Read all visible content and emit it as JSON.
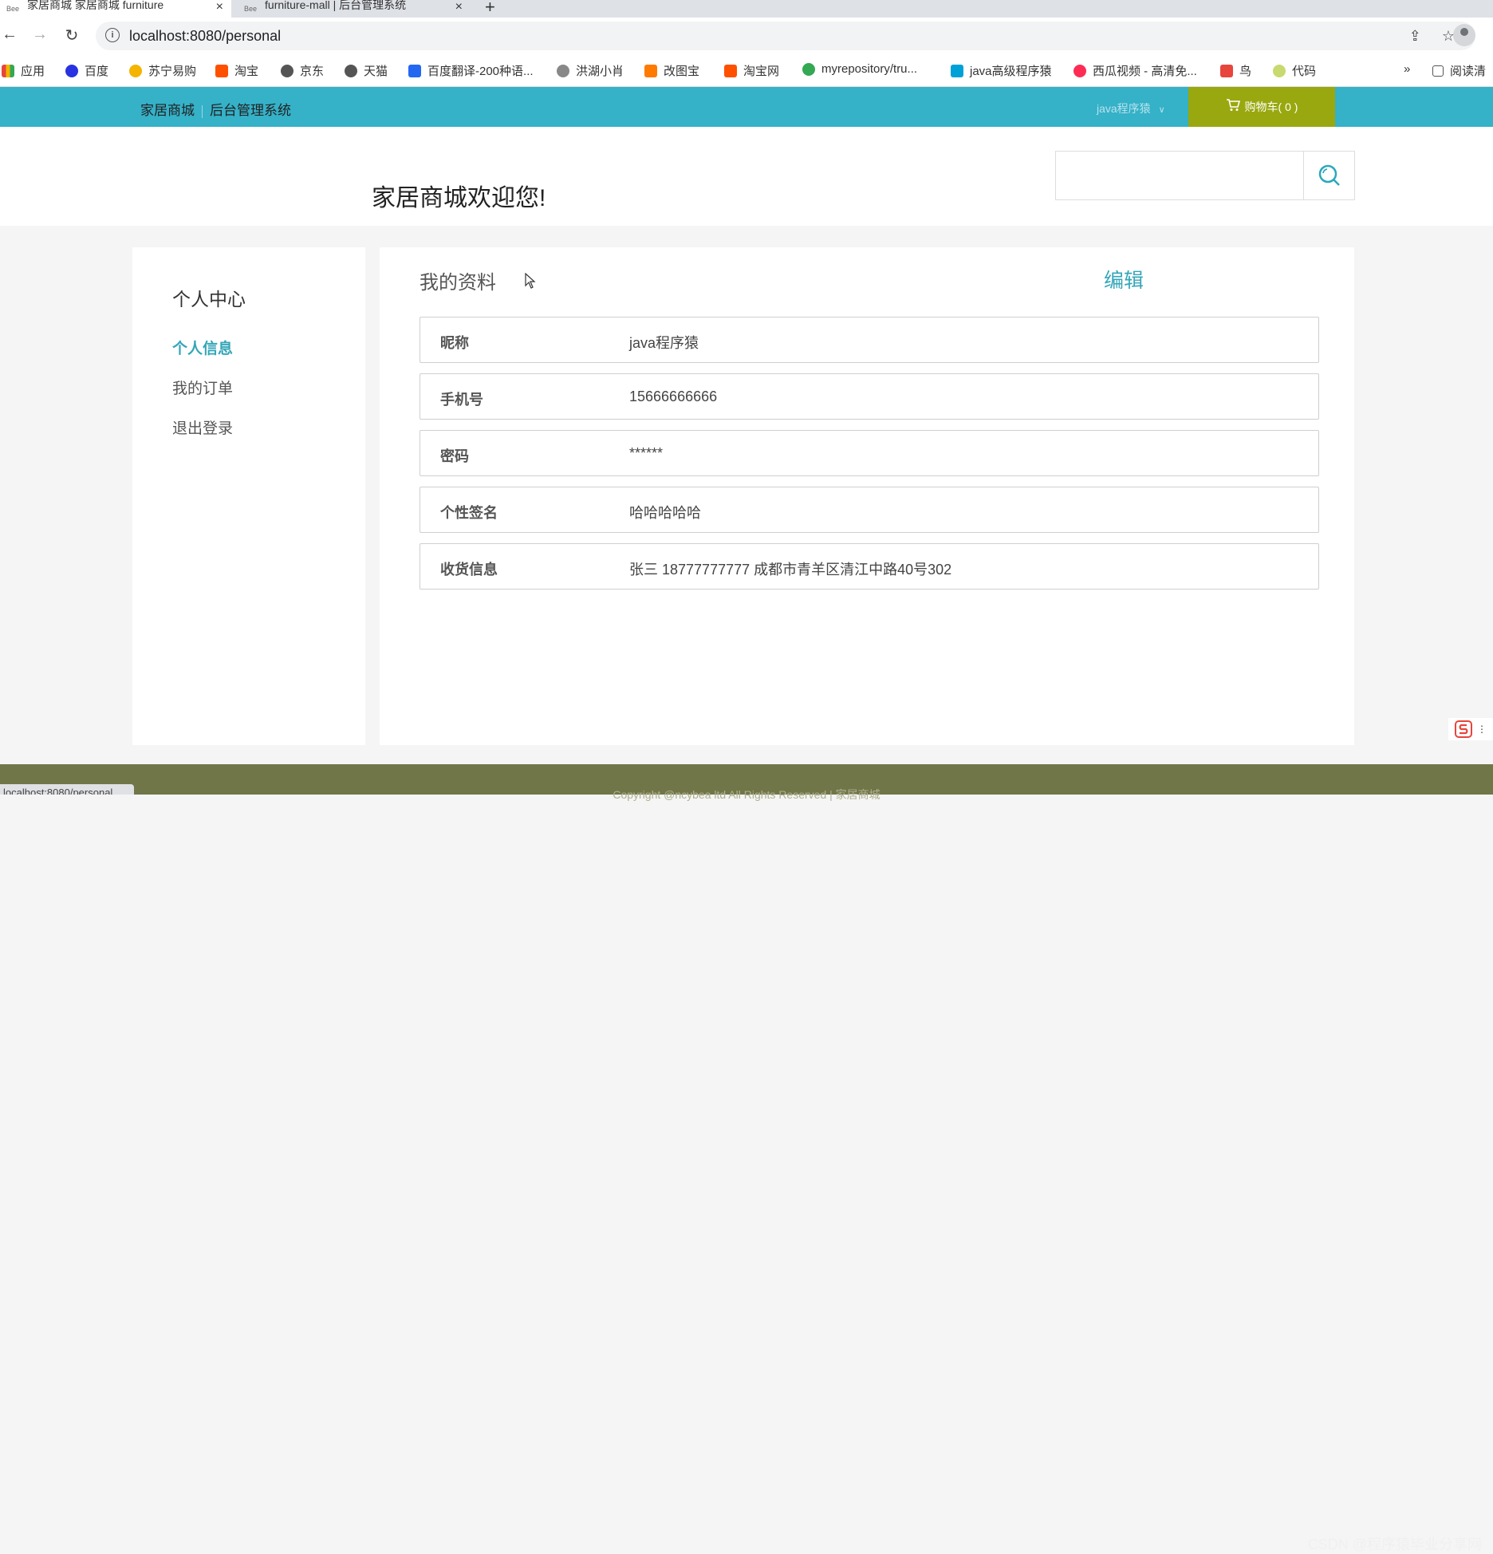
{
  "browser": {
    "tabs": [
      {
        "label": "家居商城 家居商城 furniture",
        "active": true
      },
      {
        "label": "furniture-mall | 后台管理系统",
        "active": false
      }
    ],
    "url": "localhost:8080/personal",
    "bookmarks": [
      {
        "label": "应用",
        "color": "#e8453c"
      },
      {
        "label": "百度",
        "color": "#2932e1"
      },
      {
        "label": "苏宁易购",
        "color": "#f4b400"
      },
      {
        "label": "淘宝",
        "color": "#ff5000"
      },
      {
        "label": "京东",
        "color": "#555555"
      },
      {
        "label": "天猫",
        "color": "#555555"
      },
      {
        "label": "百度翻译-200种语...",
        "color": "#2468f2"
      },
      {
        "label": "洪湖小肖",
        "color": "#888888"
      },
      {
        "label": "改图宝",
        "color": "#ff7a00"
      },
      {
        "label": "淘宝网",
        "color": "#ff5000"
      },
      {
        "label": "myrepository/tru...",
        "color": "#34a853"
      },
      {
        "label": "java高级程序猿",
        "color": "#00a1d6"
      },
      {
        "label": "西瓜视频 - 高清免...",
        "color": "#fe2c55"
      },
      {
        "label": "鸟",
        "color": "#e8453c"
      },
      {
        "label": "代码",
        "color": "#c8d96f"
      }
    ],
    "bookmarks_more": "»",
    "reading_list": "阅读清",
    "status_url": "localhost:8080/personal"
  },
  "site": {
    "nav_home": "家居商城",
    "nav_admin": "后台管理系统",
    "user_name": "java程序猿",
    "cart_label": "购物车( 0 )",
    "welcome": "家居商城欢迎您!",
    "search_placeholder": ""
  },
  "sidebar": {
    "title": "个人中心",
    "items": [
      {
        "label": "个人信息",
        "active": true
      },
      {
        "label": "我的订单",
        "active": false
      },
      {
        "label": "退出登录",
        "active": false
      }
    ]
  },
  "profile": {
    "title": "我的资料",
    "edit_label": "编辑",
    "rows": [
      {
        "label": "昵称",
        "value": "java程序猿"
      },
      {
        "label": "手机号",
        "value": "15666666666"
      },
      {
        "label": "密码",
        "value": "******"
      },
      {
        "label": "个性签名",
        "value": "哈哈哈哈哈"
      },
      {
        "label": "收货信息",
        "value": "张三 18777777777 成都市青羊区清江中路40号302"
      }
    ]
  },
  "footer": {
    "copyright": "Copyright @ncybea ltd All Rights Reserved  |  家居商城"
  },
  "watermark": "CSDN @程序猿毕业分享网",
  "colors": {
    "accent": "#35b1c8",
    "cart": "#99a80f",
    "active_link": "#35a6b8",
    "footer": "#717648"
  }
}
